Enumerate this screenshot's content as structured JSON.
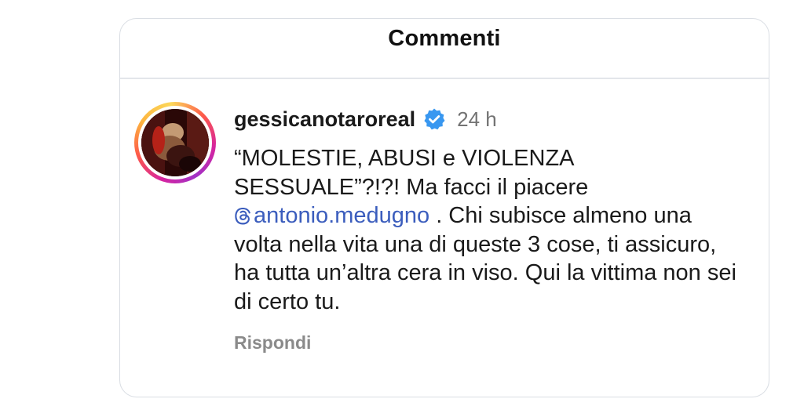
{
  "header": {
    "title": "Commenti"
  },
  "comment": {
    "username": "gessicanotaroreal",
    "verified": true,
    "time": "24 h",
    "text_before": "“MOLESTIE, ABUSI e VIOLENZA SESSUALE”?!?! Ma facci il piacere",
    "mention": "antonio.medugno",
    "text_after": " . Chi subisce almeno una volta nella vita una di queste 3 cose, ti assicuro, ha tutta un’altra cera in viso. Qui la vittima non sei di certo tu.",
    "reply_label": "Rispondi"
  },
  "colors": {
    "verified_badge": "#3897f0",
    "mention": "#3b5dbd",
    "secondary_text": "#737373"
  },
  "icons": {
    "verified": "verified-badge-icon",
    "threads": "threads-icon"
  }
}
